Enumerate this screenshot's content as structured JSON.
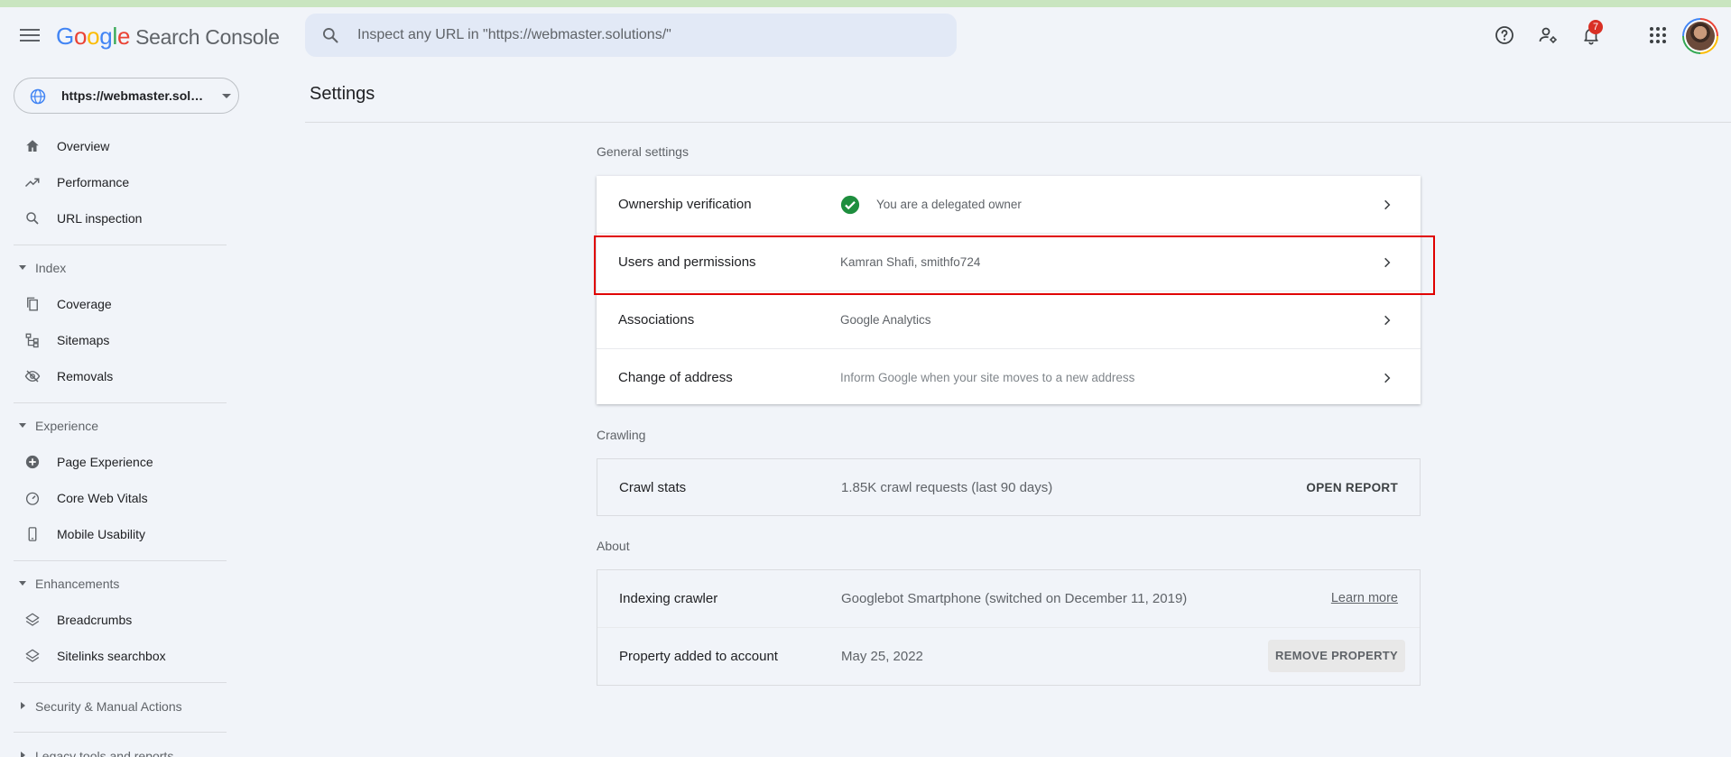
{
  "header": {
    "logo_parts": [
      "G",
      "o",
      "o",
      "g",
      "l",
      "e"
    ],
    "product_name": "Search Console",
    "search_placeholder": "Inspect any URL in \"https://webmaster.solutions/\"",
    "notifications_count": "7"
  },
  "sidebar": {
    "property": "https://webmaster.solutions/",
    "top_items": [
      {
        "label": "Overview",
        "icon": "home-icon"
      },
      {
        "label": "Performance",
        "icon": "trending-up-icon"
      },
      {
        "label": "URL inspection",
        "icon": "search-icon"
      }
    ],
    "sections": [
      {
        "label": "Index",
        "expanded": true,
        "items": [
          {
            "label": "Coverage",
            "icon": "file-copy-icon"
          },
          {
            "label": "Sitemaps",
            "icon": "sitemap-icon"
          },
          {
            "label": "Removals",
            "icon": "visibility-off-icon"
          }
        ]
      },
      {
        "label": "Experience",
        "expanded": true,
        "items": [
          {
            "label": "Page Experience",
            "icon": "add-circle-icon"
          },
          {
            "label": "Core Web Vitals",
            "icon": "speed-icon"
          },
          {
            "label": "Mobile Usability",
            "icon": "smartphone-icon"
          }
        ]
      },
      {
        "label": "Enhancements",
        "expanded": true,
        "items": [
          {
            "label": "Breadcrumbs",
            "icon": "layers-icon"
          },
          {
            "label": "Sitelinks searchbox",
            "icon": "layers-icon"
          }
        ]
      },
      {
        "label": "Security & Manual Actions",
        "expanded": false,
        "items": []
      },
      {
        "label": "Legacy tools and reports",
        "expanded": false,
        "items": []
      }
    ]
  },
  "main": {
    "title": "Settings",
    "general": {
      "label": "General settings",
      "rows": [
        {
          "label": "Ownership verification",
          "value": "You are a delegated owner"
        },
        {
          "label": "Users and permissions",
          "value": "Kamran Shafi, smithfo724"
        },
        {
          "label": "Associations",
          "value": "Google Analytics"
        },
        {
          "label": "Change of address",
          "value": "Inform Google when your site moves to a new address"
        }
      ]
    },
    "crawling": {
      "label": "Crawling",
      "row": {
        "label": "Crawl stats",
        "value": "1.85K crawl requests (last 90 days)",
        "action": "OPEN REPORT"
      }
    },
    "about": {
      "label": "About",
      "rows": [
        {
          "label": "Indexing crawler",
          "value": "Googlebot Smartphone (switched on December 11, 2019)",
          "action": "Learn more"
        },
        {
          "label": "Property added to account",
          "value": "May 25, 2022",
          "action": "REMOVE PROPERTY"
        }
      ]
    }
  },
  "colors": {
    "background": "#f1f4f9",
    "search_bg": "#e2e9f6",
    "success_green": "#1e8e3e",
    "highlight_red": "#e00000",
    "badge_red": "#d93025"
  }
}
